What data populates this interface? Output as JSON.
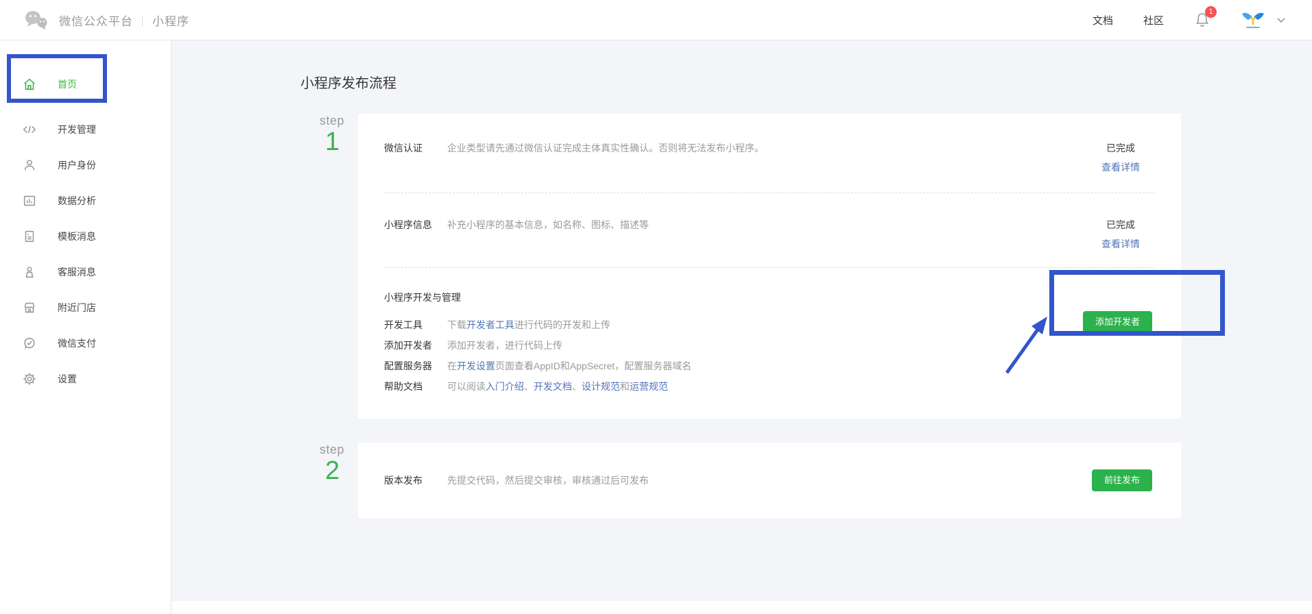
{
  "colors": {
    "accent_green": "#44b549",
    "button_green": "#2bb24c",
    "link_blue": "#5276b9",
    "annotation_blue": "#3355cc",
    "badge_red": "#fa5151"
  },
  "header": {
    "brand": "微信公众平台",
    "separator": "｜",
    "product": "小程序",
    "nav_docs": "文档",
    "nav_community": "社区",
    "notification_badge": "1"
  },
  "sidebar": {
    "items": [
      {
        "label": "首页"
      },
      {
        "label": "开发管理"
      },
      {
        "label": "用户身份"
      },
      {
        "label": "数据分析"
      },
      {
        "label": "模板消息"
      },
      {
        "label": "客服消息"
      },
      {
        "label": "附近门店"
      },
      {
        "label": "微信支付"
      },
      {
        "label": "设置"
      }
    ]
  },
  "main": {
    "title": "小程序发布流程",
    "step1": {
      "step_label": "step",
      "step_number": "1",
      "row_auth": {
        "label": "微信认证",
        "desc": "企业类型请先通过微信认证完成主体真实性确认。否则将无法发布小程序。",
        "status": "已完成",
        "link": "查看详情"
      },
      "row_info": {
        "label": "小程序信息",
        "desc": "补充小程序的基本信息，如名称、图标、描述等",
        "status": "已完成",
        "link": "查看详情"
      },
      "dev": {
        "section_title": "小程序开发与管理",
        "button": "添加开发者",
        "tool": {
          "label": "开发工具",
          "pre": "下载",
          "link": "开发者工具",
          "post": "进行代码的开发和上传"
        },
        "adddev": {
          "label": "添加开发者",
          "desc": "添加开发者，进行代码上传"
        },
        "server": {
          "label": "配置服务器",
          "pre": "在",
          "link": "开发设置",
          "post": "页面查看AppID和AppSecret，配置服务器域名"
        },
        "help": {
          "label": "帮助文档",
          "pre": "可以阅读",
          "link_a": "入门介绍",
          "sep_a": "、",
          "link_b": "开发文档",
          "sep_b": "、",
          "link_c": "设计规范",
          "sep_c": "和",
          "link_d": "运营规范"
        }
      }
    },
    "step2": {
      "step_label": "step",
      "step_number": "2",
      "row_release": {
        "label": "版本发布",
        "desc": "先提交代码，然后提交审核，审核通过后可发布",
        "button": "前往发布"
      }
    }
  }
}
